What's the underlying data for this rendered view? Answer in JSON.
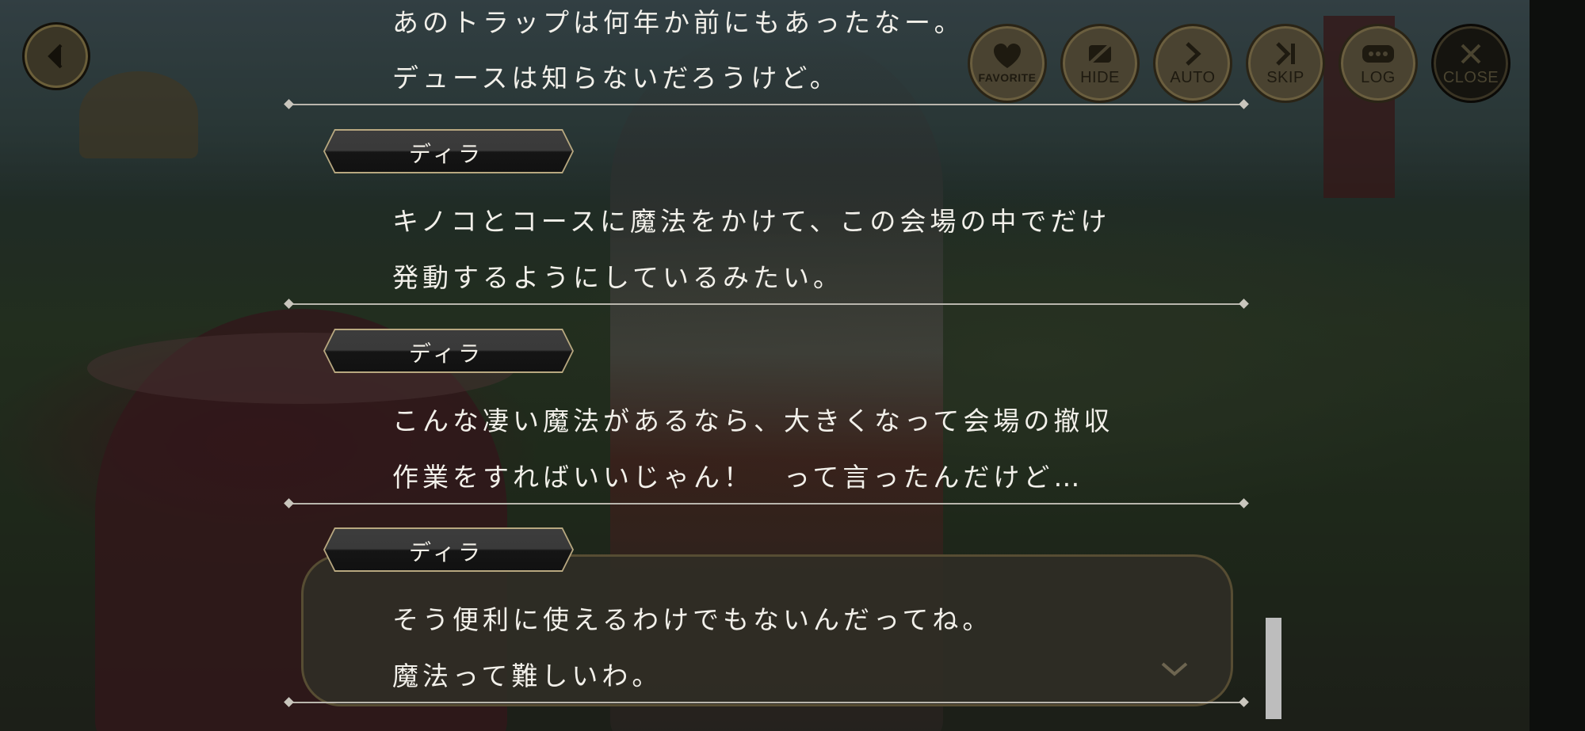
{
  "top_bar": {
    "back_icon": "chevron-left-icon",
    "buttons": [
      {
        "label": "FAVORITE",
        "icon": "heart-icon"
      },
      {
        "label": "HIDE",
        "icon": "eye-slash-icon"
      },
      {
        "label": "AUTO",
        "icon": "play-icon"
      },
      {
        "label": "SKIP",
        "icon": "skip-icon"
      },
      {
        "label": "LOG",
        "icon": "chat-bubble-icon"
      },
      {
        "label": "CLOSE",
        "icon": "close-icon"
      }
    ]
  },
  "log": {
    "entries": [
      {
        "speaker": "",
        "lines": [
          "あのトラップは何年か前にもあったなー。",
          "デュースは知らないだろうけど。"
        ]
      },
      {
        "speaker": "ディラ",
        "lines": [
          "キノコとコースに魔法をかけて、この会場の中でだけ",
          "発動するようにしているみたい。"
        ]
      },
      {
        "speaker": "ディラ",
        "lines": [
          "こんな凄い魔法があるなら、大きくなって会場の撤収",
          "作業をすればいいじゃん！　って言ったんだけど…"
        ]
      },
      {
        "speaker": "ディラ",
        "lines": [
          "そう便利に使えるわけでもないんだってね。",
          "魔法って難しいわ。"
        ]
      }
    ]
  },
  "colors": {
    "button_fill": "#4a4331",
    "text": "#f2f0ea",
    "separator": "#b9b6ad"
  }
}
